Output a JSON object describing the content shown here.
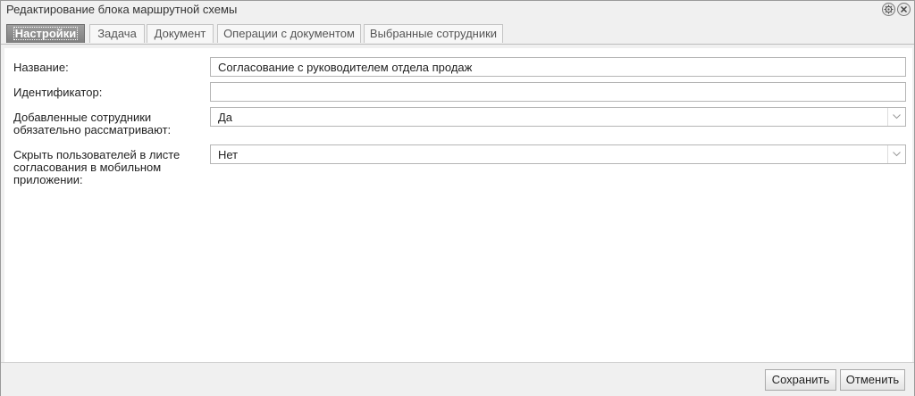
{
  "window": {
    "title": "Редактирование блока маршрутной схемы"
  },
  "tabs": [
    {
      "label": "Настройки",
      "active": true
    },
    {
      "label": "Задача",
      "active": false
    },
    {
      "label": "Документ",
      "active": false
    },
    {
      "label": "Операции с документом",
      "active": false
    },
    {
      "label": "Выбранные сотрудники",
      "active": false
    }
  ],
  "form": {
    "name_label": "Название:",
    "name_value": "Согласование с руководителем отдела продаж",
    "id_label": "Идентификатор:",
    "id_value": "",
    "added_label_line1": "Добавленные сотрудники",
    "added_label_line2": "обязательно рассматривают:",
    "added_value": "Да",
    "hide_label_line1": "Скрыть пользователей в листе",
    "hide_label_line2": "согласования в мобильном",
    "hide_label_line3": "приложении:",
    "hide_value": "Нет"
  },
  "footer": {
    "save_label": "Сохранить",
    "cancel_label": "Отменить"
  },
  "icons": {
    "settings": "settings-icon",
    "close": "close-icon",
    "dropdown": "chevron-down-icon"
  }
}
